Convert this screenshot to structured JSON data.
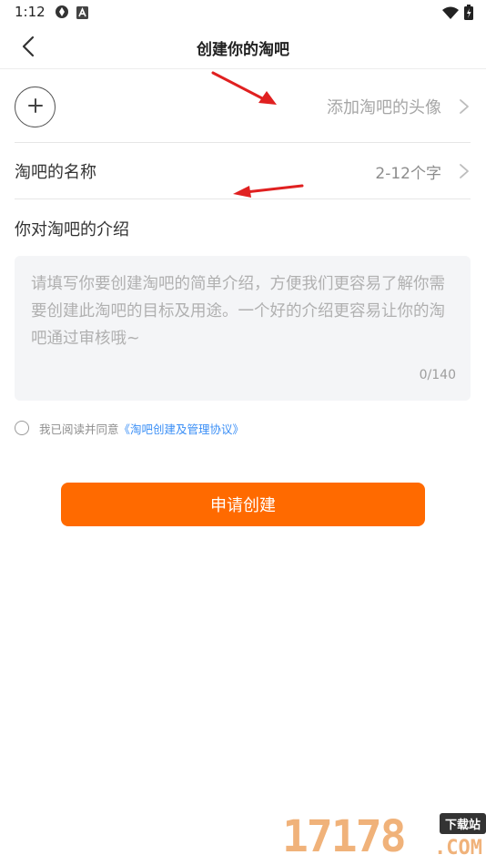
{
  "status_bar": {
    "time": "1:12",
    "left_icons": [
      "sync-icon",
      "a-badge-icon"
    ],
    "right_icons": [
      "wifi-icon",
      "battery-icon"
    ]
  },
  "header": {
    "title": "创建你的淘吧",
    "back_icon": "chevron-left-icon"
  },
  "form": {
    "avatar": {
      "hint": "添加淘吧的头像",
      "icon": "plus-icon"
    },
    "name": {
      "label": "淘吧的名称",
      "hint": "2-12个字"
    },
    "intro": {
      "label": "你对淘吧的介绍",
      "placeholder": "请填写你要创建淘吧的简单介绍，方便我们更容易了解你需要创建此淘吧的目标及用途。一个好的介绍更容易让你的淘吧通过审核哦~",
      "counter": "0/140"
    },
    "agreement": {
      "checked": false,
      "prefix": "我已阅读并同意",
      "link": "《淘吧创建及管理协议》"
    }
  },
  "actions": {
    "submit_label": "申请创建"
  },
  "watermark": {
    "number": "17178",
    "badge": "下载站",
    "suffix": ".COM"
  },
  "colors": {
    "accent": "#ff6a00",
    "link": "#3b8ff6",
    "annotation_arrow": "#e02020"
  }
}
